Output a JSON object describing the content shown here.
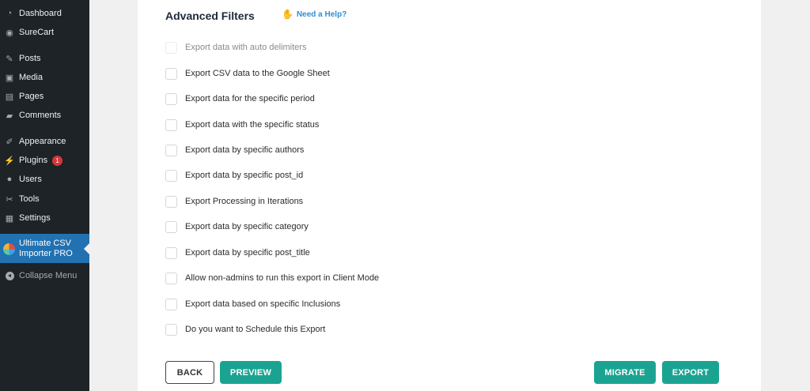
{
  "sidebar": {
    "items": [
      {
        "label": "Dashboard",
        "icon": "dashboard-icon",
        "glyph": "◔"
      },
      {
        "label": "SureCart",
        "icon": "surecart-icon",
        "glyph": "◉"
      },
      {
        "label": "Posts",
        "icon": "pin-icon",
        "glyph": "✎"
      },
      {
        "label": "Media",
        "icon": "media-icon",
        "glyph": "▣"
      },
      {
        "label": "Pages",
        "icon": "pages-icon",
        "glyph": "▤"
      },
      {
        "label": "Comments",
        "icon": "comment-icon",
        "glyph": "▰"
      },
      {
        "label": "Appearance",
        "icon": "brush-icon",
        "glyph": "✐"
      },
      {
        "label": "Plugins",
        "icon": "plugin-icon",
        "glyph": "⚡",
        "badge": "1"
      },
      {
        "label": "Users",
        "icon": "user-icon",
        "glyph": "●"
      },
      {
        "label": "Tools",
        "icon": "wrench-icon",
        "glyph": "✂"
      },
      {
        "label": "Settings",
        "icon": "settings-icon",
        "glyph": "▦"
      }
    ],
    "active": {
      "label_line1": "Ultimate CSV",
      "label_line2": "Importer PRO"
    },
    "collapse_label": "Collapse Menu"
  },
  "main": {
    "heading": "Advanced Filters",
    "help_label": "Need a Help?",
    "options": [
      "Export data with auto delimiters",
      "Export CSV data to the Google Sheet",
      "Export data for the specific period",
      "Export data with the specific status",
      "Export data by specific authors",
      "Export data by specific post_id",
      "Export Processing in Iterations",
      "Export data by specific category",
      "Export data by specific post_title",
      "Allow non-admins to run this export in Client Mode",
      "Export data based on specific Inclusions",
      "Do you want to Schedule this Export"
    ],
    "buttons": {
      "back": "BACK",
      "preview": "PREVIEW",
      "migrate": "MIGRATE",
      "export": "EXPORT"
    }
  },
  "colors": {
    "sidebar_bg": "#1d2327",
    "active_bg": "#2271b1",
    "accent": "#1ba392",
    "link": "#2e8fd4"
  }
}
